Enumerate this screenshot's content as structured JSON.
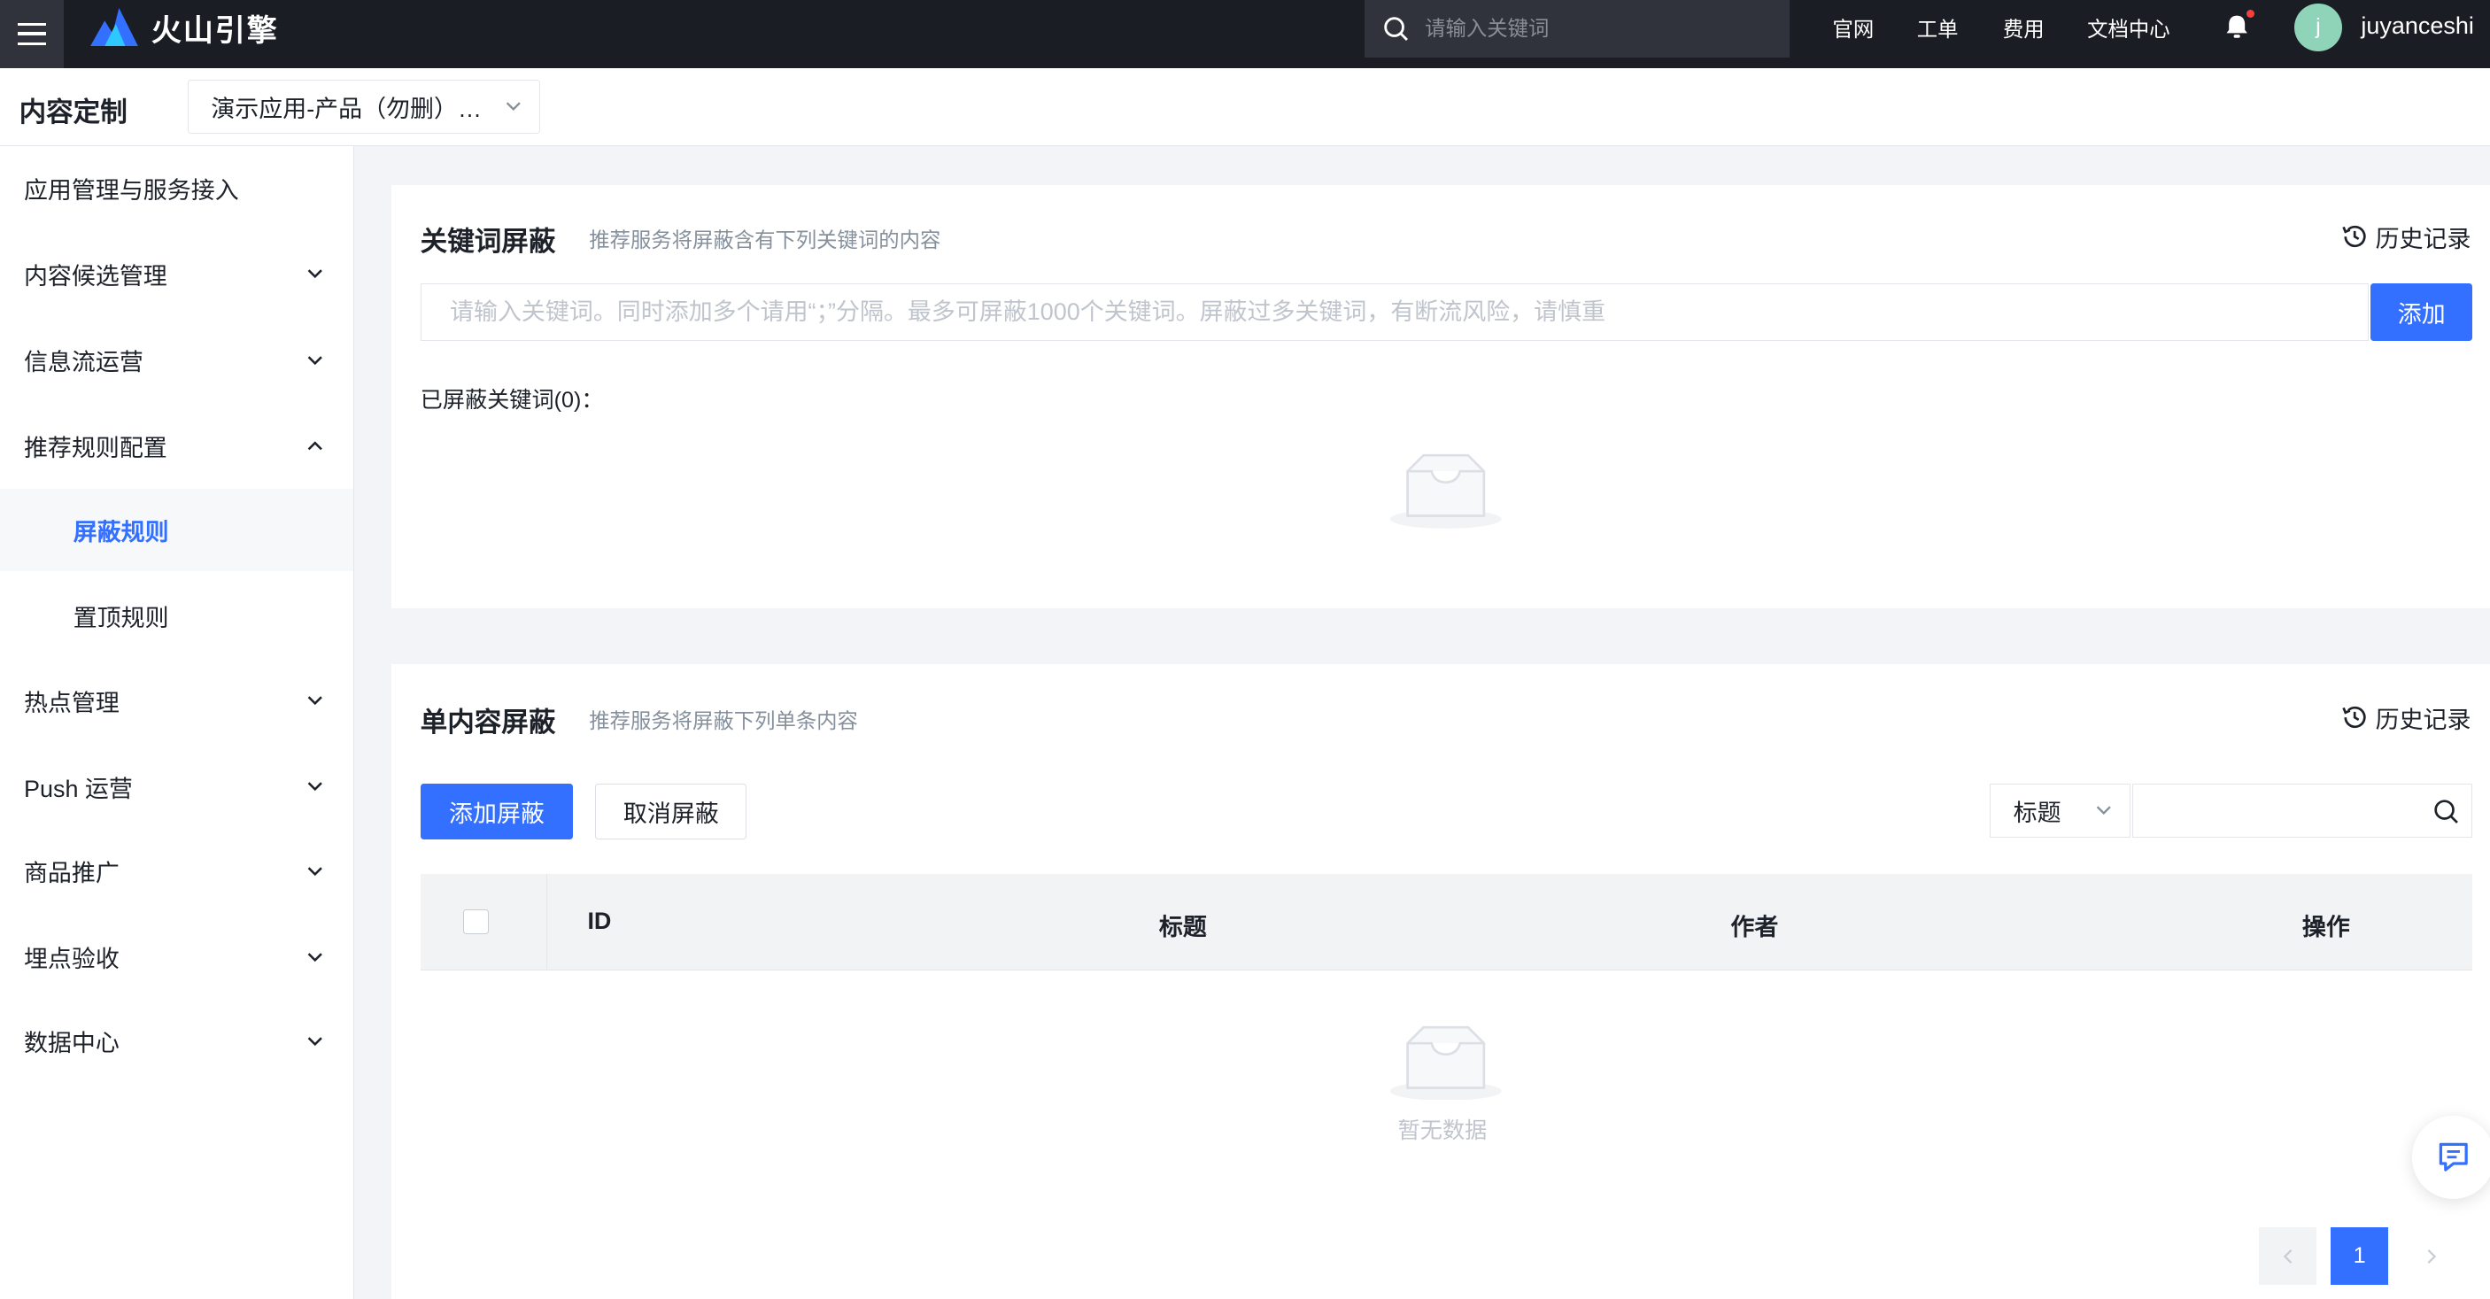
{
  "topbar": {
    "logo_text": "火山引擎",
    "search_placeholder": "请输入关键词",
    "links": [
      "官网",
      "工单",
      "费用",
      "文档中心"
    ],
    "avatar_letter": "j",
    "username": "juyanceshi"
  },
  "subheader": {
    "title": "内容定制",
    "app_selected": "演示应用-产品（勿删）…"
  },
  "sidebar": {
    "items": [
      {
        "label": "应用管理与服务接入"
      },
      {
        "label": "内容候选管理"
      },
      {
        "label": "信息流运营"
      },
      {
        "label": "推荐规则配置"
      },
      {
        "label": "屏蔽规则"
      },
      {
        "label": "置顶规则"
      },
      {
        "label": "热点管理"
      },
      {
        "label": "Push 运营"
      },
      {
        "label": "商品推广"
      },
      {
        "label": "埋点验收"
      },
      {
        "label": "数据中心"
      }
    ]
  },
  "keyword_card": {
    "title": "关键词屏蔽",
    "desc": "推荐服务将屏蔽含有下列关键词的内容",
    "history_label": "历史记录",
    "input_placeholder": "请输入关键词。同时添加多个请用“；”分隔。最多可屏蔽1000个关键词。屏蔽过多关键词，有断流风险，请慎重",
    "add_label": "添加",
    "blocked_label": "已屏蔽关键词(0)："
  },
  "content_card": {
    "title": "单内容屏蔽",
    "desc": "推荐服务将屏蔽下列单条内容",
    "history_label": "历史记录",
    "add_block_label": "添加屏蔽",
    "cancel_block_label": "取消屏蔽",
    "filter_selected": "标题",
    "columns": [
      "ID",
      "标题",
      "作者",
      "操作"
    ],
    "empty_text": "暂无数据",
    "current_page": "1"
  },
  "colors": {
    "topbar_bg": "#1b1d25",
    "primary": "#3370ff",
    "page_bg": "#f3f4f7"
  }
}
